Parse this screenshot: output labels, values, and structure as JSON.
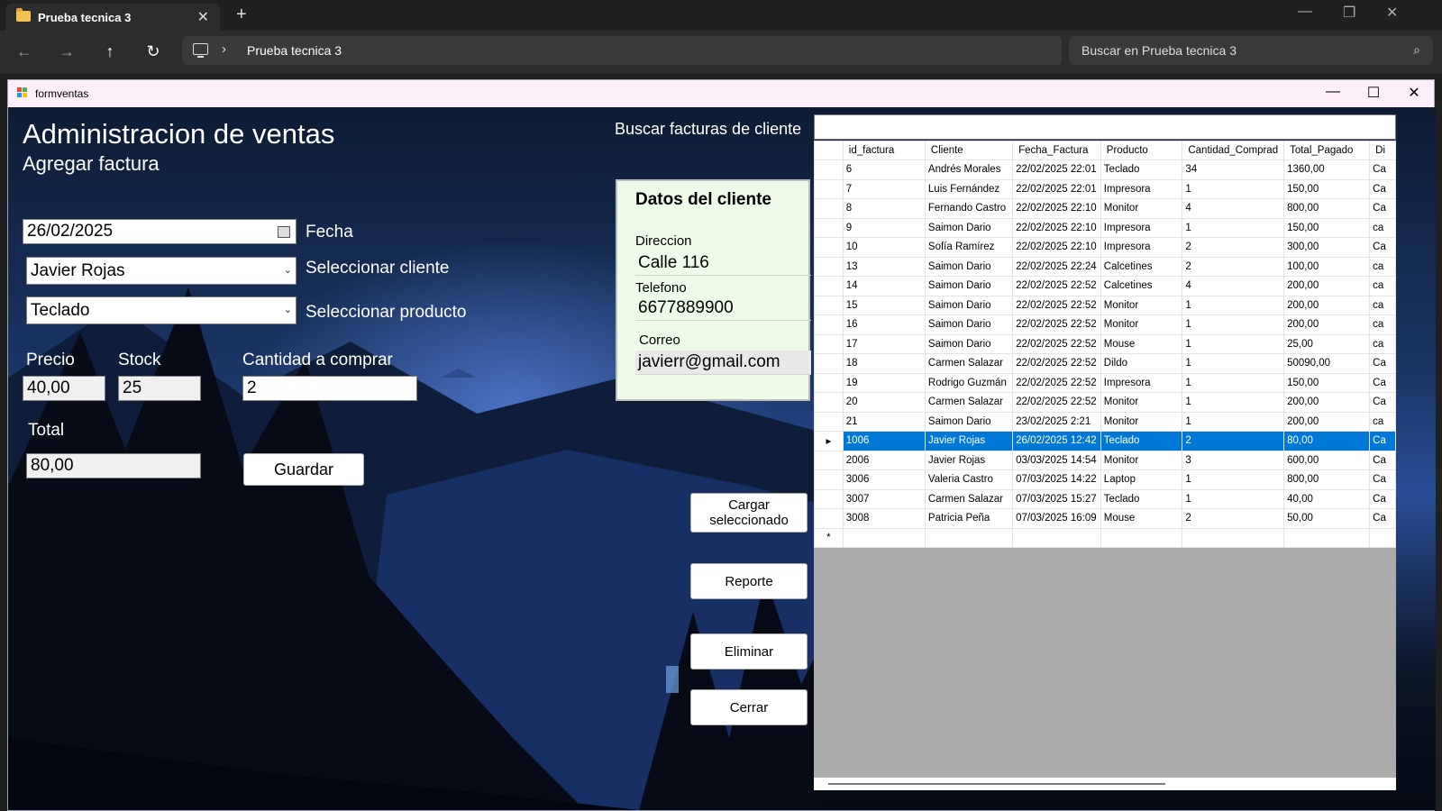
{
  "explorer": {
    "tab_title": "Prueba tecnica 3",
    "close_glyph": "✕",
    "new_tab_glyph": "+",
    "address": "Prueba tecnica 3",
    "search_placeholder": "Buscar en Prueba tecnica 3",
    "folder_color": "#f2c14e"
  },
  "form": {
    "title": "formventas",
    "heading": "Administracion de ventas",
    "subheading": "Agregar factura",
    "fecha_value": "26/02/2025",
    "fecha_label": "Fecha",
    "cliente_value": "Javier Rojas",
    "cliente_label": "Seleccionar cliente",
    "producto_value": "Teclado",
    "producto_label": "Seleccionar producto",
    "precio_label": "Precio",
    "precio_value": "40,00",
    "stock_label": "Stock",
    "stock_value": "25",
    "cantidad_label": "Cantidad a comprar",
    "cantidad_value": "2",
    "total_label": "Total",
    "total_value": "80,00",
    "guardar_label": "Guardar",
    "buscar_label": "Buscar facturas de cliente",
    "buscar_value": ""
  },
  "cliente_panel": {
    "title": "Datos del cliente",
    "direccion_label": "Direccion",
    "direccion_value": "Calle 116",
    "telefono_label": "Telefono",
    "telefono_value": "6677889900",
    "correo_label": "Correo",
    "correo_value": "javierr@gmail.com"
  },
  "actions": {
    "cargar": "Cargar seleccionado",
    "reporte": "Reporte",
    "eliminar": "Eliminar",
    "cerrar": "Cerrar"
  },
  "grid": {
    "columns": [
      "id_factura",
      "Cliente",
      "Fecha_Factura",
      "Producto",
      "Cantidad_Comprad",
      "Total_Pagado",
      "Di"
    ],
    "selected_id": "1006",
    "selection_color": "#0078d7",
    "rows": [
      [
        "6",
        "Andrés Morales",
        "22/02/2025 22:01",
        "Teclado",
        "34",
        "1360,00",
        "Ca"
      ],
      [
        "7",
        "Luis Fernández",
        "22/02/2025 22:01",
        "Impresora",
        "1",
        "150,00",
        "Ca"
      ],
      [
        "8",
        "Fernando Castro",
        "22/02/2025 22:10",
        "Monitor",
        "4",
        "800,00",
        "Ca"
      ],
      [
        "9",
        "Saimon Dario",
        "22/02/2025 22:10",
        "Impresora",
        "1",
        "150,00",
        "ca"
      ],
      [
        "10",
        "Sofía Ramírez",
        "22/02/2025 22:10",
        "Impresora",
        "2",
        "300,00",
        "Ca"
      ],
      [
        "13",
        "Saimon Dario",
        "22/02/2025 22:24",
        "Calcetines",
        "2",
        "100,00",
        "ca"
      ],
      [
        "14",
        "Saimon Dario",
        "22/02/2025 22:52",
        "Calcetines",
        "4",
        "200,00",
        "ca"
      ],
      [
        "15",
        "Saimon Dario",
        "22/02/2025 22:52",
        "Monitor",
        "1",
        "200,00",
        "ca"
      ],
      [
        "16",
        "Saimon Dario",
        "22/02/2025 22:52",
        "Monitor",
        "1",
        "200,00",
        "ca"
      ],
      [
        "17",
        "Saimon Dario",
        "22/02/2025 22:52",
        "Mouse",
        "1",
        "25,00",
        "ca"
      ],
      [
        "18",
        "Carmen Salazar",
        "22/02/2025 22:52",
        "Dildo",
        "1",
        "50090,00",
        "Ca"
      ],
      [
        "19",
        "Rodrigo Guzmán",
        "22/02/2025 22:52",
        "Impresora",
        "1",
        "150,00",
        "Ca"
      ],
      [
        "20",
        "Carmen Salazar",
        "22/02/2025 22:52",
        "Monitor",
        "1",
        "200,00",
        "Ca"
      ],
      [
        "21",
        "Saimon Dario",
        "23/02/2025 2:21",
        "Monitor",
        "1",
        "200,00",
        "ca"
      ],
      [
        "1006",
        "Javier Rojas",
        "26/02/2025 12:42",
        "Teclado",
        "2",
        "80,00",
        "Ca"
      ],
      [
        "2006",
        "Javier Rojas",
        "03/03/2025 14:54",
        "Monitor",
        "3",
        "600,00",
        "Ca"
      ],
      [
        "3006",
        "Valeria Castro",
        "07/03/2025 14:22",
        "Laptop",
        "1",
        "800,00",
        "Ca"
      ],
      [
        "3007",
        "Carmen Salazar",
        "07/03/2025 15:27",
        "Teclado",
        "1",
        "40,00",
        "Ca"
      ],
      [
        "3008",
        "Patricia Peña",
        "07/03/2025 16:09",
        "Mouse",
        "2",
        "50,00",
        "Ca"
      ]
    ]
  }
}
